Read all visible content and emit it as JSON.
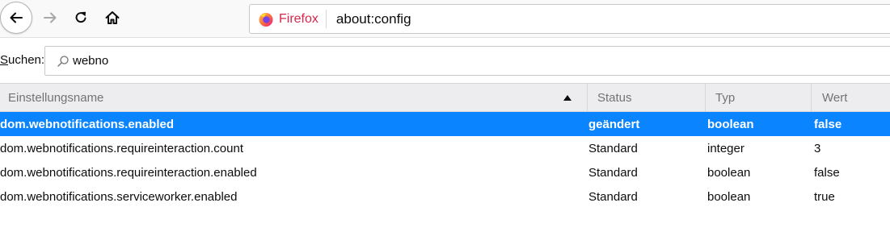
{
  "toolbar": {
    "back_icon": "arrow-left-icon",
    "forward_icon": "arrow-right-icon",
    "reload_icon": "reload-icon",
    "home_icon": "home-icon"
  },
  "urlbar": {
    "identity_label": "Firefox",
    "url": "about:config"
  },
  "search": {
    "label_accesskey": "S",
    "label_rest": "uchen:",
    "value": "webno"
  },
  "table": {
    "columns": [
      "Einstellungsname",
      "Status",
      "Typ",
      "Wert"
    ],
    "rows": [
      {
        "name": "dom.webnotifications.enabled",
        "status": "geändert",
        "type": "boolean",
        "value": "false",
        "selected": true
      },
      {
        "name": "dom.webnotifications.requireinteraction.count",
        "status": "Standard",
        "type": "integer",
        "value": "3",
        "selected": false
      },
      {
        "name": "dom.webnotifications.requireinteraction.enabled",
        "status": "Standard",
        "type": "boolean",
        "value": "false",
        "selected": false
      },
      {
        "name": "dom.webnotifications.serviceworker.enabled",
        "status": "Standard",
        "type": "boolean",
        "value": "true",
        "selected": false
      }
    ]
  },
  "colors": {
    "selection": "#0a84ff",
    "firefox_label": "#d7264b"
  }
}
